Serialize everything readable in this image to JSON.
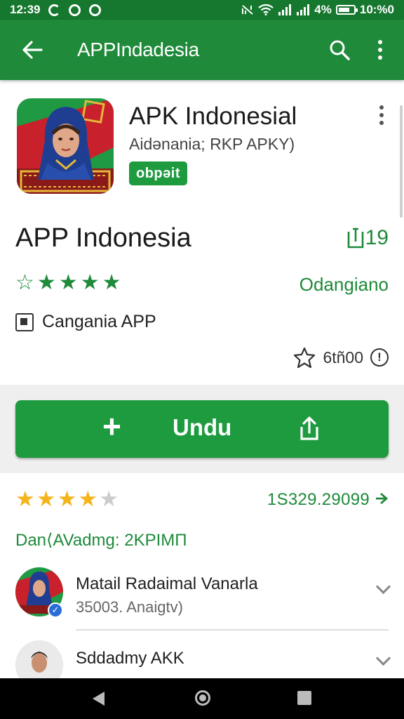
{
  "status_bar": {
    "time": "12:39",
    "battery": "4%",
    "clock_right": "10:%0"
  },
  "app_bar": {
    "title": "APPIndadesia",
    "icons": [
      "back-arrow-icon",
      "search-icon",
      "more-vert-icon"
    ]
  },
  "header": {
    "app_name": "APK Indonesial",
    "subtitle": "Aidənania; RKP APKY)",
    "badge": "obpəit"
  },
  "details": {
    "title": "APP Indonesia",
    "size_label": "19",
    "star_count": 5,
    "developer_link": "Odangiano",
    "category": "Cangania APP",
    "wishlist_count": "6tñ00"
  },
  "install": {
    "label": "Undu",
    "plus": "+"
  },
  "ratings": {
    "stars_filled": 4,
    "stars_total": 5,
    "count": "1S329.29099",
    "downloads": "Dan⟨AVadmg: 2KPIMΠ"
  },
  "reviews": [
    {
      "name": "Matail Radaimal Vanarla",
      "sub": "35003. Anaigtv)"
    },
    {
      "name": "Sddadmy AKK",
      "sub": ""
    }
  ],
  "colors": {
    "primary": "#1e8a3a",
    "status_bar": "#16772e",
    "button": "#1e9a3f",
    "star_gold": "#f5b41c"
  }
}
